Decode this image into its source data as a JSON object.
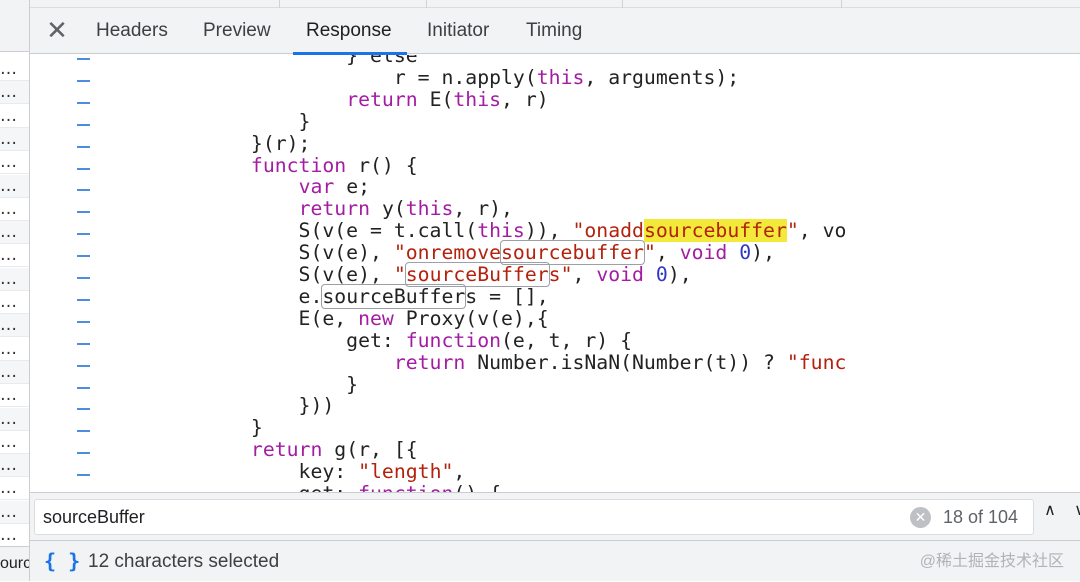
{
  "tabs": {
    "close_label": "✕",
    "items": [
      {
        "label": "Headers"
      },
      {
        "label": "Preview"
      },
      {
        "label": "Response"
      },
      {
        "label": "Initiator"
      },
      {
        "label": "Timing"
      }
    ],
    "active": "Response"
  },
  "left_list": {
    "row_text": "…",
    "bottom_text": "ourc"
  },
  "code": {
    "lines": [
      [
        [
          "                    } else",
          ""
        ]
      ],
      [
        [
          "                        r = n.apply(",
          ""
        ],
        [
          "this",
          "kw"
        ],
        [
          ", arguments);",
          ""
        ]
      ],
      [
        [
          "                    ",
          ""
        ],
        [
          "return",
          "kw"
        ],
        [
          " E(",
          ""
        ],
        [
          "this",
          "kw"
        ],
        [
          ", r)",
          ""
        ]
      ],
      [
        [
          "                }",
          ""
        ]
      ],
      [
        [
          "            }(r);",
          ""
        ]
      ],
      [
        [
          "            ",
          ""
        ],
        [
          "function",
          "kw"
        ],
        [
          " r() {",
          ""
        ]
      ],
      [
        [
          "                ",
          ""
        ],
        [
          "var",
          "kw"
        ],
        [
          " e;",
          ""
        ]
      ],
      [
        [
          "                ",
          ""
        ],
        [
          "return",
          "kw"
        ],
        [
          " y(",
          ""
        ],
        [
          "this",
          "kw"
        ],
        [
          ", r),",
          ""
        ]
      ],
      [
        [
          "                S(v(e = t.call(",
          ""
        ],
        [
          "this",
          "kw"
        ],
        [
          ")), ",
          ""
        ],
        [
          "\"onadd",
          "str"
        ],
        [
          "sourcebuffer",
          "str hl-yellow"
        ],
        [
          "\"",
          "str"
        ],
        [
          ", vo",
          ""
        ]
      ],
      [
        [
          "                S(v(e), ",
          ""
        ],
        [
          "\"onremove",
          "str"
        ],
        [
          "sourcebuffer",
          "str hl-box"
        ],
        [
          "\"",
          "str"
        ],
        [
          ", ",
          ""
        ],
        [
          "void",
          "kw"
        ],
        [
          " ",
          ""
        ],
        [
          "0",
          "num"
        ],
        [
          "),",
          ""
        ]
      ],
      [
        [
          "                S(v(e), ",
          ""
        ],
        [
          "\"",
          "str"
        ],
        [
          "sourceBuffer",
          "str hl-box"
        ],
        [
          "s\"",
          "str"
        ],
        [
          ", ",
          ""
        ],
        [
          "void",
          "kw"
        ],
        [
          " ",
          ""
        ],
        [
          "0",
          "num"
        ],
        [
          "),",
          ""
        ]
      ],
      [
        [
          "                e.",
          ""
        ],
        [
          "sourceBuffer",
          "hl-box"
        ],
        [
          "s = [],",
          ""
        ]
      ],
      [
        [
          "                E(e, ",
          ""
        ],
        [
          "new",
          "kw"
        ],
        [
          " Proxy(v(e),{",
          ""
        ]
      ],
      [
        [
          "                    get: ",
          ""
        ],
        [
          "function",
          "kw"
        ],
        [
          "(e, t, r) {",
          ""
        ]
      ],
      [
        [
          "                        ",
          ""
        ],
        [
          "return",
          "kw"
        ],
        [
          " Number.isNaN(Number(t)) ? ",
          ""
        ],
        [
          "\"func",
          "str"
        ]
      ],
      [
        [
          "                    }",
          ""
        ]
      ],
      [
        [
          "                }))",
          ""
        ]
      ],
      [
        [
          "            }",
          ""
        ]
      ],
      [
        [
          "            ",
          ""
        ],
        [
          "return",
          "kw"
        ],
        [
          " g(r, [{",
          ""
        ]
      ],
      [
        [
          "                key: ",
          ""
        ],
        [
          "\"length\"",
          "str"
        ],
        [
          ",",
          ""
        ]
      ],
      [
        [
          "                get: ",
          ""
        ],
        [
          "function",
          "kw"
        ],
        [
          "() {",
          ""
        ]
      ]
    ]
  },
  "search": {
    "query": "sourceBuffer",
    "match_count": "18 of 104",
    "clear_icon": "✕",
    "prev_icon": "∧",
    "next_icon": "∨"
  },
  "status": {
    "format_icon": "{ }",
    "text": "12 characters selected",
    "watermark": "@稀土掘金技术社区"
  },
  "colors": {
    "keyword": "#a31da3",
    "string": "#b3220c",
    "number": "#2f37c4",
    "accent": "#1a73e8",
    "match_highlight": "#f2e93b"
  }
}
